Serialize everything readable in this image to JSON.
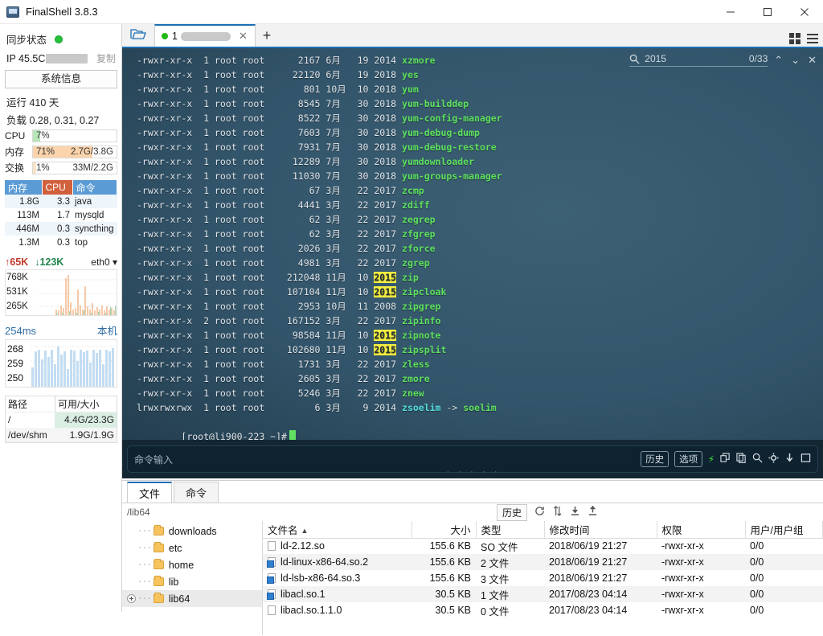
{
  "window": {
    "title": "FinalShell 3.8.3",
    "app_icon": "monitor-icon",
    "minimize": "−",
    "maximize": "□",
    "close": "✕"
  },
  "sidebar": {
    "sync_label": "同步状态",
    "sync_status_color": "#27c23c",
    "ip_label": "IP 45.5C",
    "copy_label": "复制",
    "sysinfo_button": "系统信息",
    "uptime": "运行 410 天",
    "load": "负载 0.28, 0.31, 0.27",
    "meters": [
      {
        "name": "CPU",
        "percent": "7%",
        "value": "",
        "fill_pct": 9,
        "color": "#b8e6b8"
      },
      {
        "name": "内存",
        "percent": "71%",
        "value": "2.7G/3.8G",
        "fill_pct": 71,
        "color": "#fbd4ac"
      },
      {
        "name": "交换",
        "percent": "1%",
        "value": "33M/2.2G",
        "fill_pct": 4,
        "color": "#fbe3c6"
      }
    ],
    "process_headers": {
      "mem": "内存",
      "cpu": "CPU",
      "cmd": "命令"
    },
    "processes": [
      {
        "mem": "1.8G",
        "cpu": "3.3",
        "cmd": "java",
        "mem_fill": 52,
        "cpu_fill": 40
      },
      {
        "mem": "113M",
        "cpu": "1.7",
        "cmd": "mysqld",
        "mem_fill": 6,
        "cpu_fill": 22
      },
      {
        "mem": "446M",
        "cpu": "0.3",
        "cmd": "syncthing",
        "mem_fill": 16,
        "cpu_fill": 6
      },
      {
        "mem": "1.3M",
        "cpu": "0.3",
        "cmd": "top",
        "mem_fill": 3,
        "cpu_fill": 6
      }
    ],
    "network": {
      "upload": "65K",
      "download": "123K",
      "interface": "eth0",
      "y_labels": [
        "768K",
        "531K",
        "265K"
      ]
    },
    "latency": {
      "value": "254ms",
      "host": "本机",
      "y_labels": [
        "268",
        "259",
        "250"
      ]
    },
    "disk_headers": {
      "path": "路径",
      "free": "可用/大小"
    },
    "disks": [
      {
        "path": "/",
        "free": "4.4G/23.3G",
        "highlight": true
      },
      {
        "path": "/dev/shm",
        "free": "1.9G/1.9G",
        "highlight": false
      }
    ]
  },
  "tabs": {
    "folder_icon": "open-folder-icon",
    "session_number": "1",
    "session_name_masked": true,
    "close_label": "✕",
    "add_label": "+",
    "grid_icon": "grid-view-icon",
    "list_icon": "list-view-icon"
  },
  "terminal": {
    "search": {
      "icon": "search-icon",
      "query": "2015",
      "count": "0/33",
      "prev": "⌃",
      "next": "⌄",
      "close": "✕"
    },
    "lines": [
      {
        "perm": "-rwxr-xr-x",
        "links": "1",
        "owner": "root",
        "group": "root",
        "size": "2167",
        "month": "6月",
        "day": "19",
        "year": "2014",
        "name": "xzmore",
        "type": "file"
      },
      {
        "perm": "-rwxr-xr-x",
        "links": "1",
        "owner": "root",
        "group": "root",
        "size": "22120",
        "month": "6月",
        "day": "19",
        "year": "2018",
        "name": "yes",
        "type": "file"
      },
      {
        "perm": "-rwxr-xr-x",
        "links": "1",
        "owner": "root",
        "group": "root",
        "size": "801",
        "month": "10月",
        "day": "10",
        "year": "2018",
        "name": "yum",
        "type": "file"
      },
      {
        "perm": "-rwxr-xr-x",
        "links": "1",
        "owner": "root",
        "group": "root",
        "size": "8545",
        "month": "7月",
        "day": "30",
        "year": "2018",
        "name": "yum-builddep",
        "type": "file"
      },
      {
        "perm": "-rwxr-xr-x",
        "links": "1",
        "owner": "root",
        "group": "root",
        "size": "8522",
        "month": "7月",
        "day": "30",
        "year": "2018",
        "name": "yum-config-manager",
        "type": "file"
      },
      {
        "perm": "-rwxr-xr-x",
        "links": "1",
        "owner": "root",
        "group": "root",
        "size": "7603",
        "month": "7月",
        "day": "30",
        "year": "2018",
        "name": "yum-debug-dump",
        "type": "file"
      },
      {
        "perm": "-rwxr-xr-x",
        "links": "1",
        "owner": "root",
        "group": "root",
        "size": "7931",
        "month": "7月",
        "day": "30",
        "year": "2018",
        "name": "yum-debug-restore",
        "type": "file"
      },
      {
        "perm": "-rwxr-xr-x",
        "links": "1",
        "owner": "root",
        "group": "root",
        "size": "12289",
        "month": "7月",
        "day": "30",
        "year": "2018",
        "name": "yumdownloader",
        "type": "file"
      },
      {
        "perm": "-rwxr-xr-x",
        "links": "1",
        "owner": "root",
        "group": "root",
        "size": "11030",
        "month": "7月",
        "day": "30",
        "year": "2018",
        "name": "yum-groups-manager",
        "type": "file"
      },
      {
        "perm": "-rwxr-xr-x",
        "links": "1",
        "owner": "root",
        "group": "root",
        "size": "67",
        "month": "3月",
        "day": "22",
        "year": "2017",
        "name": "zcmp",
        "type": "file"
      },
      {
        "perm": "-rwxr-xr-x",
        "links": "1",
        "owner": "root",
        "group": "root",
        "size": "4441",
        "month": "3月",
        "day": "22",
        "year": "2017",
        "name": "zdiff",
        "type": "file"
      },
      {
        "perm": "-rwxr-xr-x",
        "links": "1",
        "owner": "root",
        "group": "root",
        "size": "62",
        "month": "3月",
        "day": "22",
        "year": "2017",
        "name": "zegrep",
        "type": "file"
      },
      {
        "perm": "-rwxr-xr-x",
        "links": "1",
        "owner": "root",
        "group": "root",
        "size": "62",
        "month": "3月",
        "day": "22",
        "year": "2017",
        "name": "zfgrep",
        "type": "file"
      },
      {
        "perm": "-rwxr-xr-x",
        "links": "1",
        "owner": "root",
        "group": "root",
        "size": "2026",
        "month": "3月",
        "day": "22",
        "year": "2017",
        "name": "zforce",
        "type": "file"
      },
      {
        "perm": "-rwxr-xr-x",
        "links": "1",
        "owner": "root",
        "group": "root",
        "size": "4981",
        "month": "3月",
        "day": "22",
        "year": "2017",
        "name": "zgrep",
        "type": "file"
      },
      {
        "perm": "-rwxr-xr-x",
        "links": "1",
        "owner": "root",
        "group": "root",
        "size": "212048",
        "month": "11月",
        "day": "10",
        "year": "2015",
        "name": "zip",
        "type": "file",
        "year_highlight": true
      },
      {
        "perm": "-rwxr-xr-x",
        "links": "1",
        "owner": "root",
        "group": "root",
        "size": "107104",
        "month": "11月",
        "day": "10",
        "year": "2015",
        "name": "zipcloak",
        "type": "file",
        "year_highlight": true
      },
      {
        "perm": "-rwxr-xr-x",
        "links": "1",
        "owner": "root",
        "group": "root",
        "size": "2953",
        "month": "10月",
        "day": "11",
        "year": "2008",
        "name": "zipgrep",
        "type": "file"
      },
      {
        "perm": "-rwxr-xr-x",
        "links": "2",
        "owner": "root",
        "group": "root",
        "size": "167152",
        "month": "3月",
        "day": "22",
        "year": "2017",
        "name": "zipinfo",
        "type": "file"
      },
      {
        "perm": "-rwxr-xr-x",
        "links": "1",
        "owner": "root",
        "group": "root",
        "size": "98584",
        "month": "11月",
        "day": "10",
        "year": "2015",
        "name": "zipnote",
        "type": "file",
        "year_highlight": true
      },
      {
        "perm": "-rwxr-xr-x",
        "links": "1",
        "owner": "root",
        "group": "root",
        "size": "102680",
        "month": "11月",
        "day": "10",
        "year": "2015",
        "name": "zipsplit",
        "type": "file",
        "year_highlight": true
      },
      {
        "perm": "-rwxr-xr-x",
        "links": "1",
        "owner": "root",
        "group": "root",
        "size": "1731",
        "month": "3月",
        "day": "22",
        "year": "2017",
        "name": "zless",
        "type": "file"
      },
      {
        "perm": "-rwxr-xr-x",
        "links": "1",
        "owner": "root",
        "group": "root",
        "size": "2605",
        "month": "3月",
        "day": "22",
        "year": "2017",
        "name": "zmore",
        "type": "file"
      },
      {
        "perm": "-rwxr-xr-x",
        "links": "1",
        "owner": "root",
        "group": "root",
        "size": "5246",
        "month": "3月",
        "day": "22",
        "year": "2017",
        "name": "znew",
        "type": "file"
      },
      {
        "perm": "lrwxrwxrwx",
        "links": "1",
        "owner": "root",
        "group": "root",
        "size": "6",
        "month": "3月",
        "day": "9",
        "year": "2014",
        "name": "zsoelim",
        "type": "link",
        "target": "soelim"
      }
    ],
    "prompt": "[root@li900-223 ~]#",
    "command_placeholder": "命令输入",
    "buttons": {
      "history": "历史",
      "options": "选项"
    },
    "icons": [
      "bolt-icon",
      "split-icon",
      "copy-icon",
      "search-icon",
      "gear-icon",
      "download-icon",
      "window-icon"
    ]
  },
  "bottom_panel": {
    "tabs": [
      {
        "label": "文件",
        "active": true
      },
      {
        "label": "命令",
        "active": false
      }
    ],
    "path": "/lib64",
    "toolbar": {
      "history": "历史",
      "refresh_icon": "refresh-icon",
      "updown_icon": "transfer-icon",
      "download_icon": "download-icon",
      "upload_icon": "upload-icon"
    },
    "tree": [
      {
        "label": "downloads",
        "expandable": false,
        "selected": false
      },
      {
        "label": "etc",
        "expandable": false,
        "selected": false
      },
      {
        "label": "home",
        "expandable": false,
        "selected": false
      },
      {
        "label": "lib",
        "expandable": false,
        "selected": false
      },
      {
        "label": "lib64",
        "expandable": true,
        "selected": true
      }
    ],
    "columns": [
      "文件名",
      "大小",
      "类型",
      "修改时间",
      "权限",
      "用户/用户组"
    ],
    "sort_indicator": "▲",
    "files": [
      {
        "name": "ld-2.12.so",
        "size": "155.6 KB",
        "type": "SO 文件",
        "mtime": "2018/06/19 21:27",
        "perm": "-rwxr-xr-x",
        "owner": "0/0",
        "icon": "file-icon"
      },
      {
        "name": "ld-linux-x86-64.so.2",
        "size": "155.6 KB",
        "type": "2 文件",
        "mtime": "2018/06/19 21:27",
        "perm": "-rwxr-xr-x",
        "owner": "0/0",
        "icon": "link-file-icon"
      },
      {
        "name": "ld-lsb-x86-64.so.3",
        "size": "155.6 KB",
        "type": "3 文件",
        "mtime": "2018/06/19 21:27",
        "perm": "-rwxr-xr-x",
        "owner": "0/0",
        "icon": "link-file-icon"
      },
      {
        "name": "libacl.so.1",
        "size": "30.5 KB",
        "type": "1 文件",
        "mtime": "2017/08/23 04:14",
        "perm": "-rwxr-xr-x",
        "owner": "0/0",
        "icon": "link-file-icon"
      },
      {
        "name": "libacl.so.1.1.0",
        "size": "30.5 KB",
        "type": "0 文件",
        "mtime": "2017/08/23 04:14",
        "perm": "-rwxr-xr-x",
        "owner": "0/0",
        "icon": "file-icon"
      }
    ]
  }
}
